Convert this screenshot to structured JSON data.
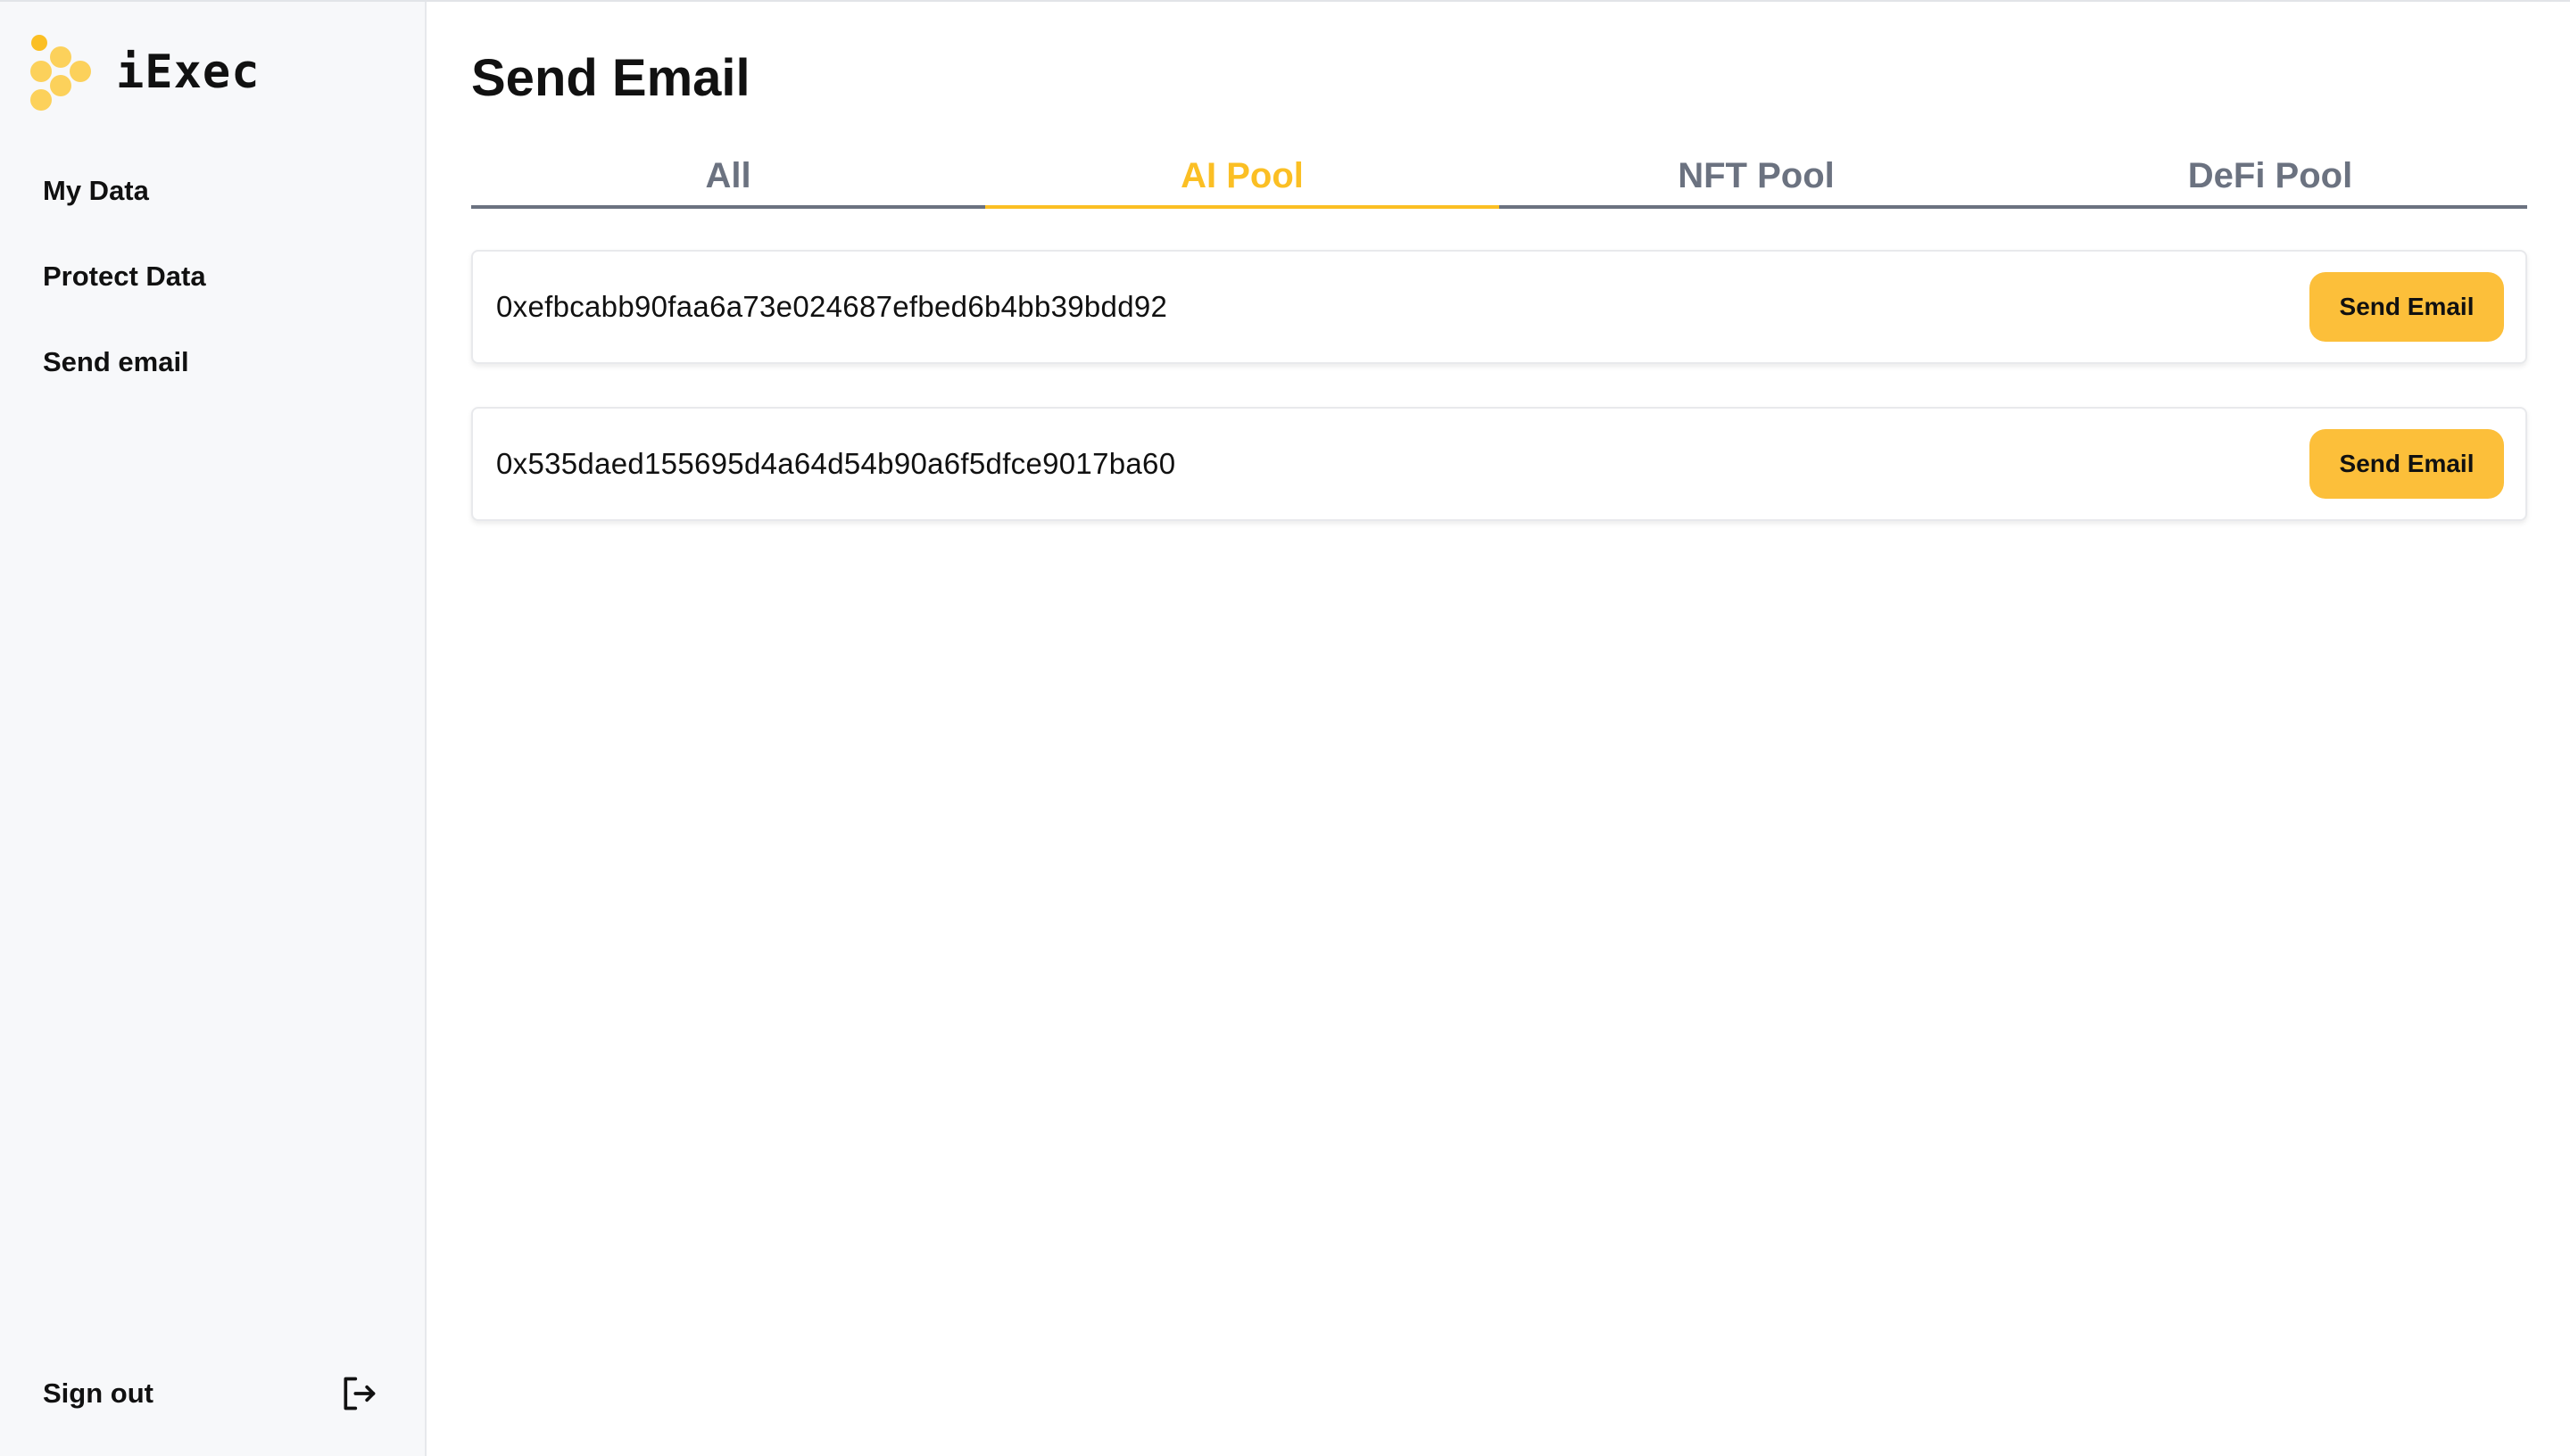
{
  "brand": {
    "name": "iExec"
  },
  "sidebar": {
    "items": [
      {
        "label": "My Data"
      },
      {
        "label": "Protect Data"
      },
      {
        "label": "Send email"
      }
    ],
    "signout_label": "Sign out"
  },
  "page": {
    "title": "Send Email"
  },
  "tabs": [
    {
      "label": "All",
      "active": false
    },
    {
      "label": "AI Pool",
      "active": true
    },
    {
      "label": "NFT Pool",
      "active": false
    },
    {
      "label": "DeFi Pool",
      "active": false
    }
  ],
  "rows": [
    {
      "address": "0xefbcabb90faa6a73e024687efbed6b4bb39bdd92",
      "button_label": "Send Email"
    },
    {
      "address": "0x535daed155695d4a64d54b90a6f5dfce9017ba60",
      "button_label": "Send Email"
    }
  ],
  "icons": {
    "logo": "iexec-logo-icon",
    "signout": "sign-out-icon"
  },
  "colors": {
    "accent": "#fbbf24",
    "button": "#fcbf3a",
    "tab_inactive": "#6b7280",
    "sidebar_bg": "#f7f8fa"
  }
}
